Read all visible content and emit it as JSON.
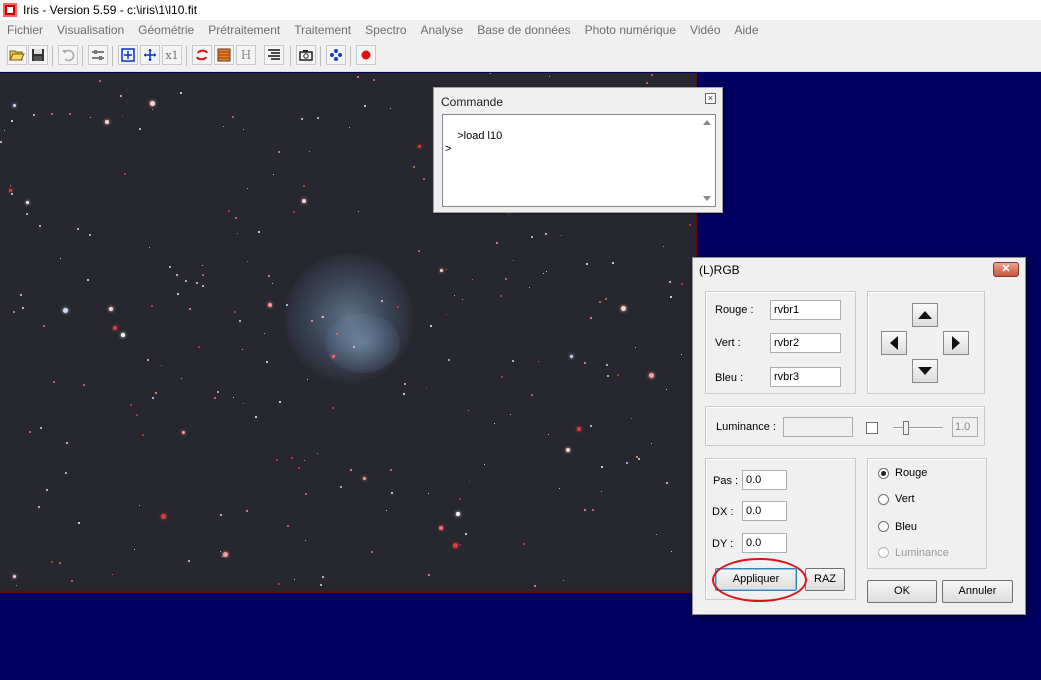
{
  "window": {
    "title": "Iris - Version 5.59 - c:\\iris\\1\\l10.fit"
  },
  "menu": [
    "Fichier",
    "Visualisation",
    "Géométrie",
    "Prétraitement",
    "Traitement",
    "Spectro",
    "Analyse",
    "Base de données",
    "Photo numérique",
    "Vidéo",
    "Aide"
  ],
  "toolbar": {
    "buttons": [
      {
        "name": "open-folder-icon"
      },
      {
        "name": "save-disk-icon"
      },
      {
        "name": "undo-icon"
      },
      {
        "name": "threshold-sliders-icon"
      },
      {
        "name": "zoom-in-icon"
      },
      {
        "name": "zoom-out-icon"
      },
      {
        "name": "zoom-1x-icon",
        "label": "x1"
      },
      {
        "name": "red-swirl-icon"
      },
      {
        "name": "palette-icon"
      },
      {
        "name": "histogram-icon",
        "label": "H"
      },
      {
        "name": "list-icon"
      },
      {
        "name": "camera-icon"
      },
      {
        "name": "blue-cross-icon"
      },
      {
        "name": "record-dot-icon"
      }
    ]
  },
  "command_window": {
    "title": "Commande",
    "text": ">load l10\n>"
  },
  "rgb_dialog": {
    "title": "(L)RGB",
    "channels": {
      "rouge_label": "Rouge :",
      "rouge_value": "rvbr1",
      "vert_label": "Vert :",
      "vert_value": "rvbr2",
      "bleu_label": "Bleu :",
      "bleu_value": "rvbr3"
    },
    "luminance": {
      "label": "Luminance :",
      "value": "",
      "slider_value": "1.0",
      "checked": false
    },
    "offsets": {
      "pas_label": "Pas :",
      "pas_value": "0.0",
      "dx_label": "DX :",
      "dx_value": "0.0",
      "dy_label": "DY :",
      "dy_value": "0.0"
    },
    "channel_select": [
      {
        "label": "Rouge",
        "checked": true,
        "enabled": true
      },
      {
        "label": "Vert",
        "checked": false,
        "enabled": true
      },
      {
        "label": "Bleu",
        "checked": false,
        "enabled": true
      },
      {
        "label": "Luminance",
        "checked": false,
        "enabled": false
      }
    ],
    "buttons": {
      "appliquer": "Appliquer",
      "raz": "RAZ",
      "ok": "OK",
      "annuler": "Annuler"
    }
  },
  "colors": {
    "canvas_background": "#27272f",
    "desktop_background": "#000060",
    "highlight_ring": "#d9151b",
    "disabled_text": "#9a9a9a"
  }
}
